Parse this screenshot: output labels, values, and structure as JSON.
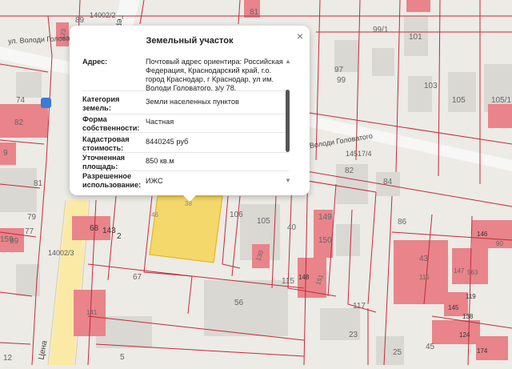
{
  "popup": {
    "title": "Земельный участок",
    "rows": [
      {
        "key": "Адрес:",
        "value": "Почтовый адрес ориентира: Российская Федерация, Краснодарский край, г.о. город Краснодар, г Краснодар, ул им. Володи Головатого, з/у 78."
      },
      {
        "key": "Категория земель:",
        "value": "Земли населенных пунктов"
      },
      {
        "key": "Форма собственности:",
        "value": "Частная"
      },
      {
        "key": "Кадастровая стоимость:",
        "value": "8440245 руб"
      },
      {
        "key": "Уточненная площадь:",
        "value": "850 кв.м"
      },
      {
        "key": "Разрешенное использование:",
        "value": "ИЖС"
      }
    ],
    "close_icon": "close-icon"
  },
  "map": {
    "streets": {
      "top_left": "ул. Володи Головатого",
      "right": "ул. Володи Головатого",
      "vertical_top": "Герц",
      "vertical_bottom": "Цена"
    },
    "cadastral_codes": {
      "top": "14002/2",
      "right": "14517/4",
      "left": "14002/3"
    },
    "red_numbers": [
      "81",
      "123",
      "82",
      "9",
      "23",
      "159",
      "99",
      "68",
      "143",
      "2",
      "130",
      "149",
      "150",
      "148",
      "151",
      "141",
      "43",
      "115",
      "147",
      "563",
      "146",
      "90",
      "144",
      "145",
      "138",
      "124",
      "174",
      "1/1",
      "119",
      "79",
      "46",
      "38"
    ],
    "gray_numbers": [
      "89",
      "99/1",
      "101",
      "97",
      "99",
      "103",
      "105",
      "105/1",
      "74",
      "76",
      "84",
      "82",
      "81",
      "79",
      "77",
      "86",
      "106",
      "105",
      "40",
      "67",
      "56",
      "117",
      "115",
      "23",
      "25",
      "45",
      "5",
      "12"
    ],
    "parking_icon": "parking-icon"
  }
}
